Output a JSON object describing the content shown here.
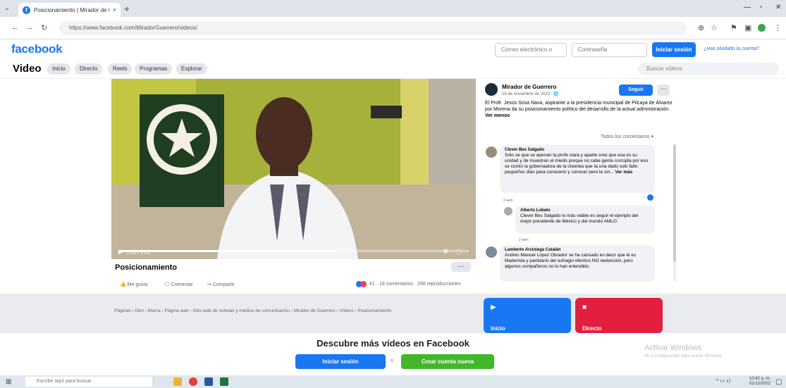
{
  "browser": {
    "tab_title": "Posicionamiento | Mirador de Guerrero",
    "url": "https://www.facebook.com/MiradorGuerrero/videos/",
    "tab_close": "×",
    "new_tab": "+"
  },
  "fb_header": {
    "logo": "facebook",
    "email_placeholder": "Correo electrónico o teléfono",
    "password_placeholder": "Contraseña",
    "login_button": "Iniciar sesión",
    "forgot_link": "¿Has olvidado la cuenta?"
  },
  "video_nav": {
    "title": "Video",
    "tabs": [
      "Inicio",
      "Directo",
      "Reels",
      "Programas",
      "Explorar"
    ],
    "search_placeholder": "Buscar vídeos"
  },
  "video": {
    "progress": 0.62,
    "time": "0:00 / 2:01"
  },
  "post": {
    "title": "Posicionamiento",
    "more": "···",
    "actions": [
      "Me gusta",
      "Comentar",
      "Compartir"
    ],
    "reaction_summary": "41 · 18 comentarios · 256 reproducciones"
  },
  "page": {
    "name": "Mirador de Guerrero",
    "date": "18 de noviembre de 2022 · 🌐",
    "follow": "Seguir",
    "more": "···",
    "description": "El Profr. Jesús Sosa Nava, aspirante a la presidencia municipal de Pilcaya de Álvarez por Morena da su posicionamiento político del desarrollo de la actual administración.",
    "see_less": "Ver menos",
    "sort": "Todos los comentarios ▾"
  },
  "comments": [
    {
      "name": "Clever Bes Salgado",
      "text": "Solo se que se apenan la profe clara y aparte creo que esa es su unidad y de muestran el miedo porque no cabe gente corrupta por eso se comió la gobernadora de la cheinba que ta una dado solo falto pequeños días para conocerlo y conocer pero le sin...",
      "see_more": "Ver más",
      "time": "2 sem"
    },
    {
      "name": "Alberto Lobato",
      "text": "Clever Bes Salgado lo más viable es seguir el ejemplo del mejor presidente de México y del mundo AMLO.",
      "time": "2 sem"
    },
    {
      "name": "Lamberto Arciniega Catalán",
      "text": "Andrés Manuel López Obrador se ha cansado en decir que él es Maderista y partidario del sufragio efectivo NO reelección, pero algunos compañeros no lo han entendido."
    }
  ],
  "footer": {
    "breadcrumb": "Páginas › Otro › Marca › Página web › Sitio web de noticias y medios de comunicación › Mirador de Guerrero › Vídeos › Posicionamiento",
    "tile_inicio": "Inicio",
    "tile_directo": "Directo"
  },
  "promo": {
    "title": "Descubre más vídeos en Facebook",
    "login": "Iniciar sesión",
    "or": "o",
    "create": "Crear cuenta nueva"
  },
  "watermark": {
    "title": "Activar Windows",
    "subtitle": "Ve a Configuración para activar Windows."
  },
  "taskbar": {
    "search": "Escribe aquí para buscar",
    "time": "10:42 a. m.",
    "date": "01/12/2022"
  }
}
